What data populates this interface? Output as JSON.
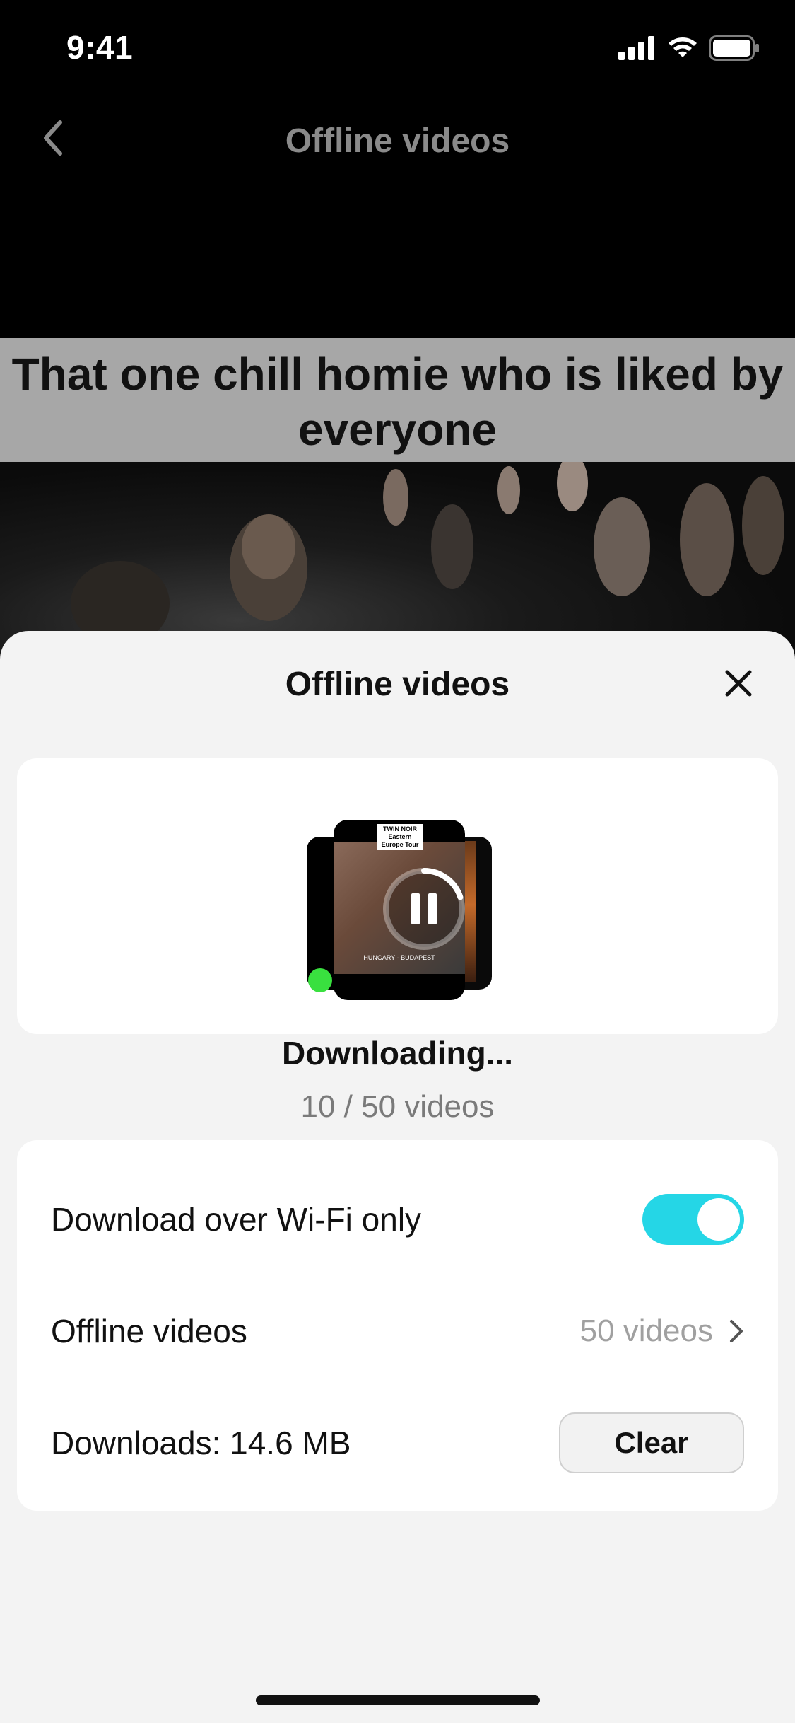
{
  "status_bar": {
    "time": "9:41"
  },
  "nav": {
    "title": "Offline videos",
    "back_icon": "chevron-left-icon"
  },
  "video": {
    "caption": "That one chill homie who is liked by everyone"
  },
  "sheet": {
    "title": "Offline videos",
    "close_icon": "close-icon",
    "download_card": {
      "thumb_label": "TWIN NOIR Eastern Europe Tour",
      "thumb_location": "HUNGARY - BUDAPEST",
      "status": "Downloading...",
      "count_text": "10 / 50 videos",
      "progress_fraction": 0.2,
      "pause_icon": "pause-icon"
    },
    "settings": {
      "wifi_label": "Download over Wi-Fi only",
      "wifi_enabled": true,
      "offline_label": "Offline videos",
      "offline_value": "50 videos",
      "downloads_label": "Downloads: 14.6 MB",
      "clear_label": "Clear"
    }
  },
  "colors": {
    "accent": "#25d6e6",
    "sheet_bg": "#f3f3f3",
    "card_bg": "#ffffff",
    "caption_band": "#a7a7a7"
  }
}
